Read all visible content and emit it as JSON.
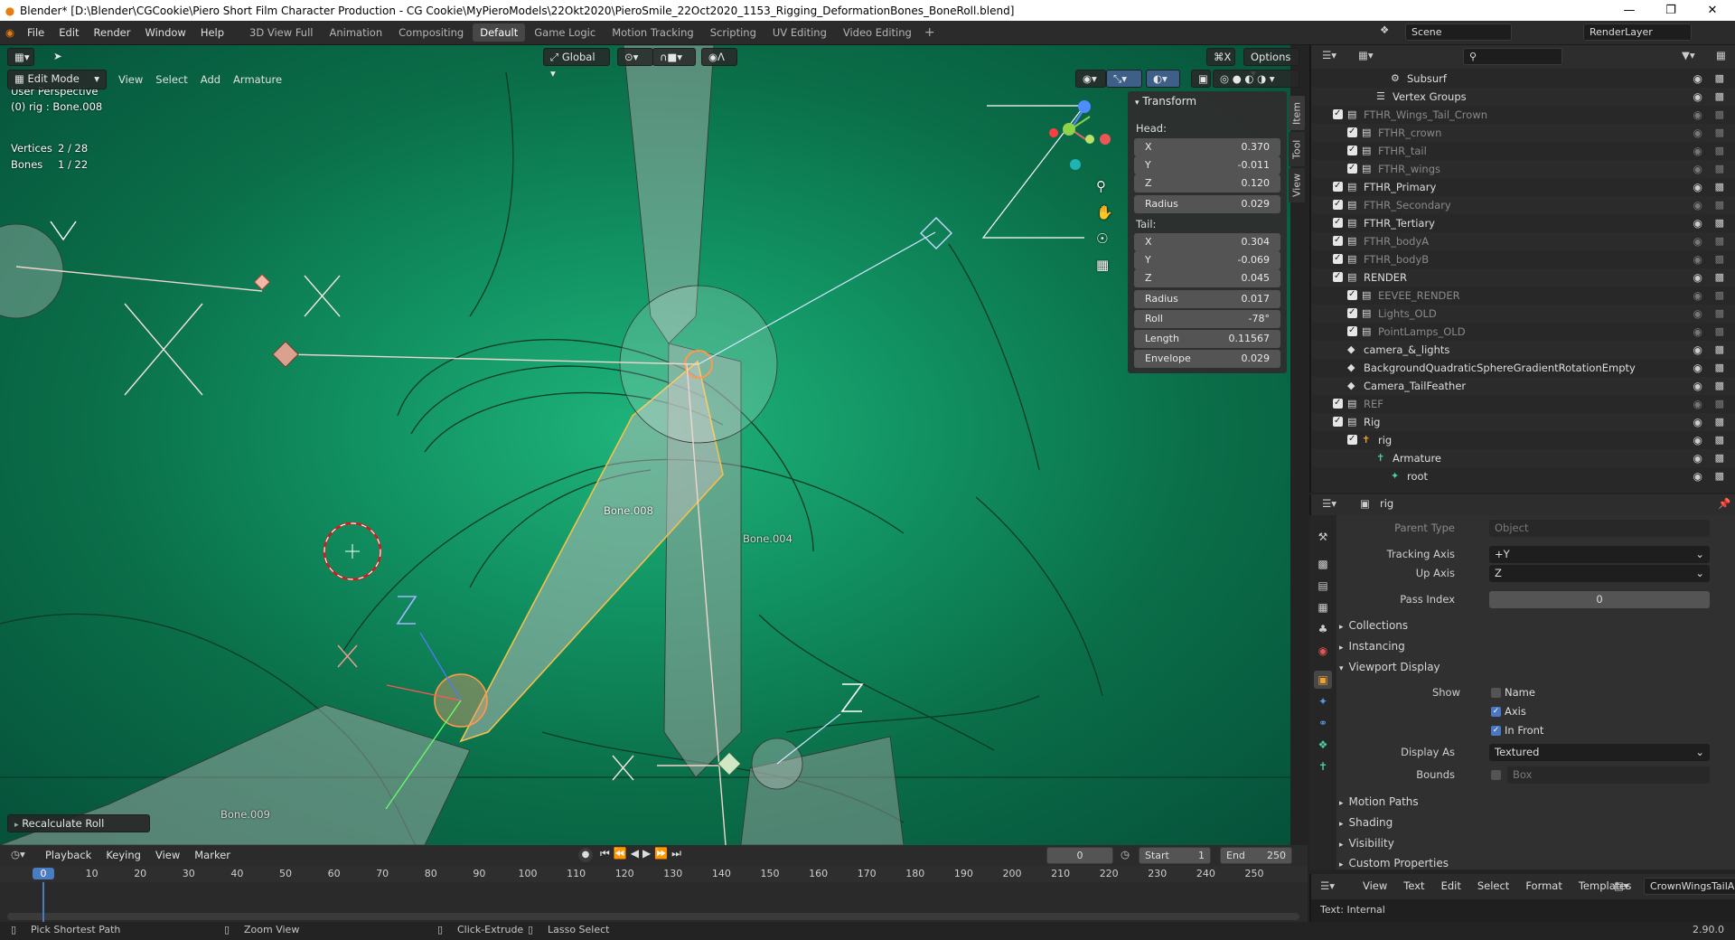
{
  "window": {
    "title": "Blender* [D:\\Blender\\CGCookie\\Piero Short Film Character Production - CG Cookie\\MyPieroModels\\22Okt2020\\PieroSmile_22Oct2020_1153_Rigging_DeformationBones_BoneRoll.blend]"
  },
  "menus": [
    "File",
    "Edit",
    "Render",
    "Window",
    "Help"
  ],
  "workspaces": [
    "3D View Full",
    "Animation",
    "Compositing",
    "Default",
    "Game Logic",
    "Motion Tracking",
    "Scripting",
    "UV Editing",
    "Video Editing"
  ],
  "active_workspace": "Default",
  "scene": {
    "label": "Scene",
    "render_layer": "RenderLayer"
  },
  "viewport": {
    "mode": "Edit Mode",
    "menus": [
      "View",
      "Select",
      "Add",
      "Armature"
    ],
    "orientation": "Global",
    "options_label": "Options",
    "x_label": "X",
    "overlay_title": "User Perspective",
    "overlay_object": "(0) rig : Bone.008",
    "stats": [
      {
        "label": "Vertices",
        "value": "2 / 28"
      },
      {
        "label": "Bones",
        "value": "1 / 22"
      }
    ],
    "bone_labels": [
      "Bone.008",
      "Bone.004",
      "Bone.009"
    ],
    "axis_letters": [
      "Y",
      "X",
      "Z",
      "X",
      "Z",
      "X",
      "Y"
    ],
    "gizmo_axes": [
      "Z",
      "Y",
      "X"
    ],
    "last_op": "Recalculate Roll",
    "ntabs": [
      "Item",
      "Tool",
      "View"
    ]
  },
  "transform": {
    "title": "Transform",
    "head_label": "Head:",
    "head": [
      {
        "label": "X",
        "value": "0.370"
      },
      {
        "label": "Y",
        "value": "-0.011"
      },
      {
        "label": "Z",
        "value": "0.120"
      }
    ],
    "head_radius": {
      "label": "Radius",
      "value": "0.029"
    },
    "tail_label": "Tail:",
    "tail": [
      {
        "label": "X",
        "value": "0.304"
      },
      {
        "label": "Y",
        "value": "-0.069"
      },
      {
        "label": "Z",
        "value": "0.045"
      }
    ],
    "tail_radius": {
      "label": "Radius",
      "value": "0.017"
    },
    "roll": {
      "label": "Roll",
      "value": "-78°"
    },
    "length": {
      "label": "Length",
      "value": "0.11567"
    },
    "envelope": {
      "label": "Envelope",
      "value": "0.029"
    }
  },
  "outliner": {
    "rows": [
      {
        "name": "Subsurf",
        "indent": 5,
        "type": "modifier",
        "dim": false
      },
      {
        "name": "Vertex Groups",
        "indent": 4,
        "type": "groups",
        "dim": false
      },
      {
        "name": "FTHR_Wings_Tail_Crown",
        "indent": 2,
        "type": "collection",
        "dim": true
      },
      {
        "name": "FTHR_crown",
        "indent": 3,
        "type": "collection",
        "dim": true
      },
      {
        "name": "FTHR_tail",
        "indent": 3,
        "type": "collection",
        "dim": true
      },
      {
        "name": "FTHR_wings",
        "indent": 3,
        "type": "collection",
        "dim": true
      },
      {
        "name": "FTHR_Primary",
        "indent": 2,
        "type": "collection",
        "dim": false
      },
      {
        "name": "FTHR_Secondary",
        "indent": 2,
        "type": "collection",
        "dim": true
      },
      {
        "name": "FTHR_Tertiary",
        "indent": 2,
        "type": "collection",
        "dim": false
      },
      {
        "name": "FTHR_bodyA",
        "indent": 2,
        "type": "collection",
        "dim": true
      },
      {
        "name": "FTHR_bodyB",
        "indent": 2,
        "type": "collection",
        "dim": true
      },
      {
        "name": "RENDER",
        "indent": 2,
        "type": "collection",
        "dim": false
      },
      {
        "name": "EEVEE_RENDER",
        "indent": 3,
        "type": "collection",
        "dim": true
      },
      {
        "name": "Lights_OLD",
        "indent": 3,
        "type": "collection",
        "dim": true
      },
      {
        "name": "PointLamps_OLD",
        "indent": 3,
        "type": "collection",
        "dim": true
      },
      {
        "name": "camera_&_lights",
        "indent": 2,
        "type": "object",
        "dim": false
      },
      {
        "name": "BackgroundQuadraticSphereGradientRotationEmpty",
        "indent": 2,
        "type": "object",
        "dim": false
      },
      {
        "name": "Camera_TailFeather",
        "indent": 2,
        "type": "object",
        "dim": false
      },
      {
        "name": "REF",
        "indent": 2,
        "type": "collection",
        "dim": true
      },
      {
        "name": "Rig",
        "indent": 2,
        "type": "collection",
        "dim": false
      },
      {
        "name": "rig",
        "indent": 3,
        "type": "armature",
        "dim": false
      },
      {
        "name": "Armature",
        "indent": 4,
        "type": "data",
        "dim": false
      },
      {
        "name": "root",
        "indent": 5,
        "type": "bone",
        "dim": false
      }
    ]
  },
  "properties": {
    "object_name": "rig",
    "parent_type": {
      "label": "Parent Type",
      "value": "Object"
    },
    "tracking_axis": {
      "label": "Tracking Axis",
      "value": "+Y"
    },
    "up_axis": {
      "label": "Up Axis",
      "value": "Z"
    },
    "pass_index": {
      "label": "Pass Index",
      "value": "0"
    },
    "sections_collapsed": [
      "Collections",
      "Instancing"
    ],
    "viewport_display": "Viewport Display",
    "show_label": "Show",
    "show_name": "Name",
    "show_axis": "Axis",
    "show_in_front": "In Front",
    "display_as": {
      "label": "Display As",
      "value": "Textured"
    },
    "bounds": {
      "label": "Bounds",
      "value": "Box"
    },
    "sections_after": [
      "Motion Paths",
      "Shading",
      "Visibility",
      "Custom Properties"
    ]
  },
  "text_editor": {
    "menus": [
      "View",
      "Text",
      "Edit",
      "Select",
      "Format",
      "Templates"
    ],
    "text_name": "CrownWingsTailArm",
    "status": "Text: Internal"
  },
  "timeline": {
    "menus": [
      "Playback",
      "Keying",
      "View",
      "Marker"
    ],
    "current_frame": "0",
    "start_label": "Start",
    "start": "1",
    "end_label": "End",
    "end": "250",
    "ticks": [
      "0",
      "10",
      "20",
      "30",
      "40",
      "50",
      "60",
      "70",
      "80",
      "90",
      "100",
      "110",
      "120",
      "130",
      "140",
      "150",
      "160",
      "170",
      "180",
      "190",
      "200",
      "210",
      "220",
      "230",
      "240",
      "250"
    ]
  },
  "statusbar": {
    "items": [
      "Pick Shortest Path",
      "Zoom View",
      "Click-Extrude",
      "Lasso Select"
    ],
    "version": "2.90.0"
  }
}
